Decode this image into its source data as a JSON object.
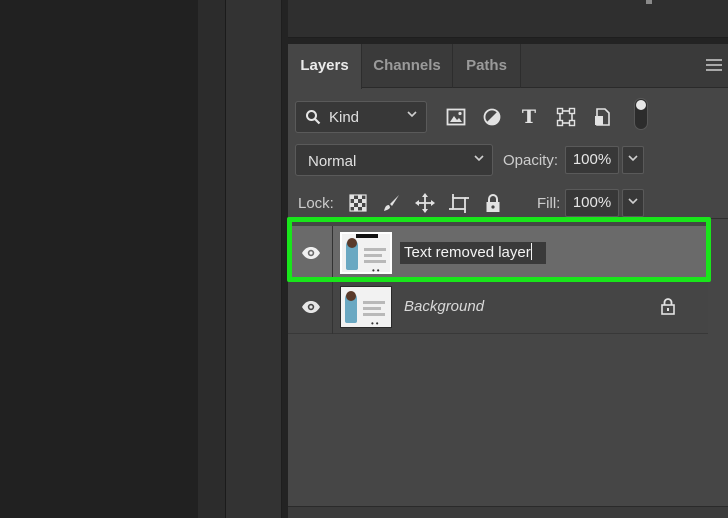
{
  "tabs": [
    {
      "label": "Layers",
      "active": true
    },
    {
      "label": "Channels",
      "active": false
    },
    {
      "label": "Paths",
      "active": false
    }
  ],
  "filter": {
    "kind_label": "Kind",
    "icons": [
      "image-filter-icon",
      "adjustment-filter-icon",
      "type-filter-icon",
      "shape-filter-icon",
      "smart-object-filter-icon"
    ]
  },
  "blend": {
    "mode": "Normal",
    "opacity_label": "Opacity:",
    "opacity_value": "100%"
  },
  "lock": {
    "label": "Lock:",
    "icons": [
      "lock-transparency-icon",
      "lock-image-pixels-icon",
      "lock-position-icon",
      "lock-artboard-icon",
      "lock-all-icon"
    ],
    "fill_label": "Fill:",
    "fill_value": "100%"
  },
  "layers": [
    {
      "name": "Text removed layer",
      "selected": true,
      "editing": true,
      "visible": true
    },
    {
      "name": "Background",
      "selected": false,
      "locked": true,
      "visible": true
    }
  ],
  "colors": {
    "highlight": "#19e51b",
    "panel": "#464646",
    "selected_row": "#6a6a6a"
  }
}
